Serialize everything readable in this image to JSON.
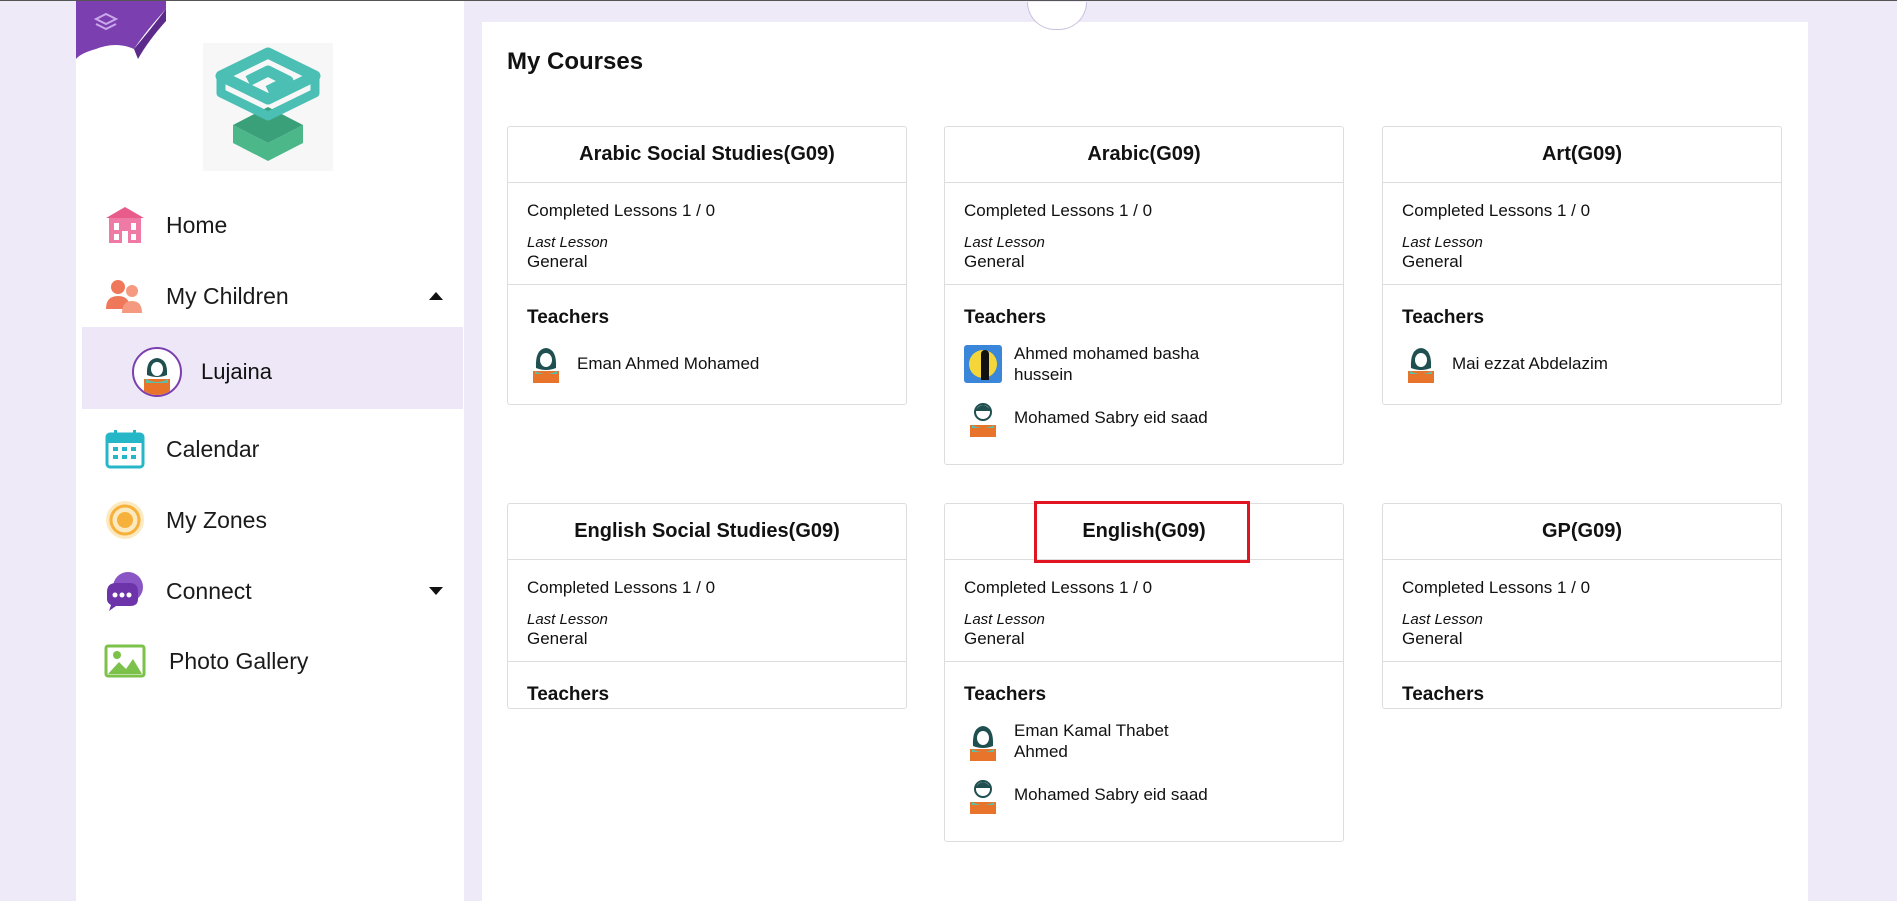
{
  "sidebar": {
    "nav": [
      {
        "label": "Home",
        "icon": "home-icon"
      },
      {
        "label": "My Children",
        "icon": "children-icon"
      },
      {
        "label": "Calendar",
        "icon": "calendar-icon"
      },
      {
        "label": "My Zones",
        "icon": "zones-icon"
      },
      {
        "label": "Connect",
        "icon": "connect-icon"
      },
      {
        "label": "Photo Gallery",
        "icon": "gallery-icon"
      }
    ],
    "child": {
      "label": "Lujaina"
    }
  },
  "main": {
    "title": "My Courses",
    "courses": [
      {
        "title": "Arabic Social Studies(G09)",
        "completed": "Completed Lessons 1 / 0",
        "last_lesson_label": "Last Lesson",
        "last_lesson": "General",
        "teachers_label": "Teachers",
        "teachers": [
          {
            "name": "Eman Ahmed Mohamed"
          }
        ]
      },
      {
        "title": "Arabic(G09)",
        "completed": "Completed Lessons 1 / 0",
        "last_lesson_label": "Last Lesson",
        "last_lesson": "General",
        "teachers_label": "Teachers",
        "teachers": [
          {
            "name": "Ahmed mohamed basha hussein"
          },
          {
            "name": "Mohamed Sabry eid saad"
          }
        ]
      },
      {
        "title": "Art(G09)",
        "completed": "Completed Lessons 1 / 0",
        "last_lesson_label": "Last Lesson",
        "last_lesson": "General",
        "teachers_label": "Teachers",
        "teachers": [
          {
            "name": "Mai ezzat Abdelazim"
          }
        ]
      },
      {
        "title": "English Social Studies(G09)",
        "completed": "Completed Lessons 1 / 0",
        "last_lesson_label": "Last Lesson",
        "last_lesson": "General",
        "teachers_label": "Teachers",
        "teachers": []
      },
      {
        "title": "English(G09)",
        "completed": "Completed Lessons 1 / 0",
        "last_lesson_label": "Last Lesson",
        "last_lesson": "General",
        "teachers_label": "Teachers",
        "teachers": [
          {
            "name": "Eman Kamal Thabet Ahmed"
          },
          {
            "name": "Mohamed Sabry eid saad"
          }
        ]
      },
      {
        "title": "GP(G09)",
        "completed": "Completed Lessons 1 / 0",
        "last_lesson_label": "Last Lesson",
        "last_lesson": "General",
        "teachers_label": "Teachers",
        "teachers": []
      }
    ]
  },
  "colors": {
    "background": "#efeaf8",
    "accent_purple": "#7b3fb0",
    "highlight_red": "#e0151f",
    "logo_teal": "#4bbfb4",
    "logo_green": "#4cb88a"
  }
}
